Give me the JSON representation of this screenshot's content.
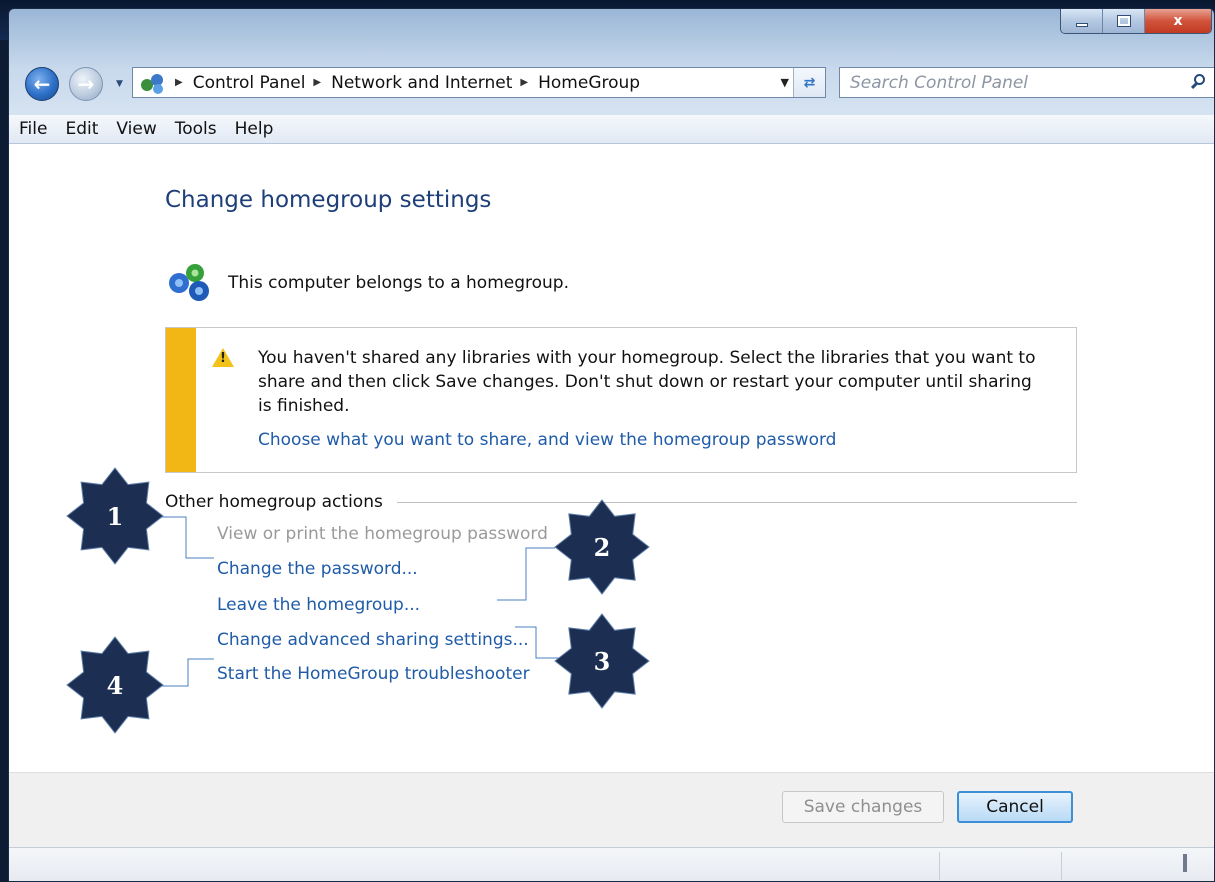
{
  "address_bar": {
    "crumbs": [
      "Control Panel",
      "Network and Internet",
      "HomeGroup"
    ]
  },
  "search": {
    "placeholder": "Search Control Panel"
  },
  "menu": [
    "File",
    "Edit",
    "View",
    "Tools",
    "Help"
  ],
  "page": {
    "title": "Change homegroup settings",
    "membership_text": "This computer belongs to a homegroup."
  },
  "notice": {
    "message_lines": [
      "You haven't shared any libraries with your homegroup. Select the libraries that you want to",
      "share and then click Save changes. Don't shut down or restart your computer until sharing",
      "is finished."
    ],
    "link": "Choose what you want to share, and view the homegroup password"
  },
  "actions": {
    "heading": "Other homegroup actions",
    "items": [
      {
        "label": "View or print the homegroup password",
        "enabled": false
      },
      {
        "label": "Change the password...",
        "enabled": true
      },
      {
        "label": "Leave the homegroup...",
        "enabled": true
      },
      {
        "label": "Change advanced sharing settings...",
        "enabled": true
      },
      {
        "label": "Start the HomeGroup troubleshooter",
        "enabled": true
      }
    ]
  },
  "callouts": [
    "1",
    "2",
    "3",
    "4"
  ],
  "buttons": {
    "save": "Save changes",
    "cancel": "Cancel"
  },
  "window_controls": {
    "close": "x"
  },
  "colors": {
    "link": "#1f5ba8",
    "title": "#1e3f79",
    "warning_bar": "#f3b715",
    "badge": "#1c2f52",
    "cancel_border": "#3d8fd6"
  }
}
